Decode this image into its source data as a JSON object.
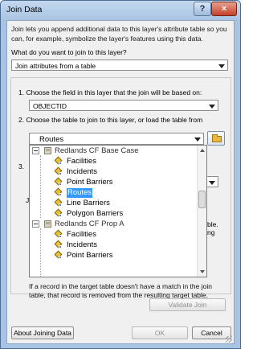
{
  "window": {
    "title": "Join Data",
    "help_label": "?",
    "close_label": "×"
  },
  "intro_text": "Join lets you append additional data to this layer's attribute table so you can, for example, symbolize the layer's features using this data.",
  "question_label": "What do you want to join to this layer?",
  "join_method": {
    "value": "Join attributes from a table"
  },
  "step1": {
    "label": "1.  Choose the field in this layer that the join will be based on:",
    "value": "OBJECTID"
  },
  "step2": {
    "label": "2.  Choose the table to join to this layer, or load the table from",
    "value": "Routes"
  },
  "step3": {
    "label": "3."
  },
  "hidden_fragments": {
    "jo": "Jo",
    "ble": "ble.",
    "ng": "ng"
  },
  "tree": {
    "items": [
      {
        "label": "Redlands CF Base Case",
        "kind": "dataset"
      },
      {
        "label": "Facilities",
        "kind": "featureclass"
      },
      {
        "label": "Incidents",
        "kind": "featureclass"
      },
      {
        "label": "Point Barriers",
        "kind": "featureclass"
      },
      {
        "label": "Routes",
        "kind": "featureclass",
        "selected": true
      },
      {
        "label": "Line Barriers",
        "kind": "featureclass"
      },
      {
        "label": "Polygon Barriers",
        "kind": "featureclass"
      },
      {
        "label": "Redlands CF Prop A",
        "kind": "dataset"
      },
      {
        "label": "Facilities",
        "kind": "featureclass"
      },
      {
        "label": "Incidents",
        "kind": "featureclass"
      },
      {
        "label": "Point Barriers",
        "kind": "featureclass"
      }
    ]
  },
  "note_text": "If a record in the target table doesn't have a match in the join table, that record is removed from the resulting target table.",
  "buttons": {
    "validate": "Validate Join",
    "about": "About Joining Data",
    "ok": "OK",
    "cancel": "Cancel"
  },
  "colors": {
    "selection": "#3399ff",
    "title_bar": "#a9c4e2",
    "close": "#c4402b"
  },
  "icons": {
    "browse": "folder-icon",
    "dataset": "dataset-icon",
    "featureclass": "feature-class-icon"
  }
}
